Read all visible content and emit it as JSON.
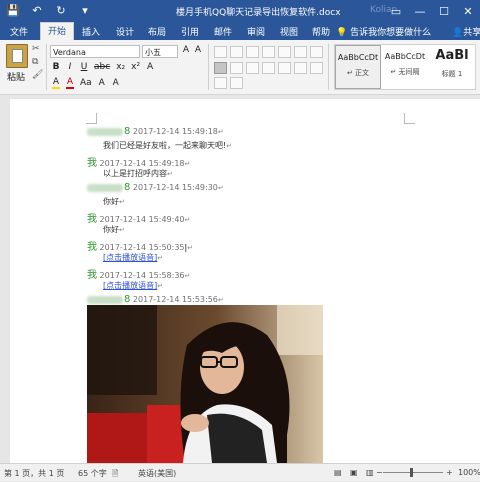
{
  "title": "楼月手机QQ聊天记录导出恢复软件.docx",
  "user": "Kolian",
  "window_controls": [
    "▭",
    "—",
    "☐",
    "✕"
  ],
  "tabs": [
    "文件",
    "开始",
    "插入",
    "设计",
    "布局",
    "引用",
    "邮件",
    "审阅",
    "视图",
    "帮助"
  ],
  "active_tab": "开始",
  "tell_me": "告诉我你想要做什么",
  "share": "共享",
  "ribbon": {
    "paste": "粘贴",
    "font_name": "Verdana",
    "font_size": "小五",
    "font_row1": [
      "A",
      "A",
      "Aa",
      "A",
      "wén",
      "A"
    ],
    "font_row2": [
      "B",
      "I",
      "U",
      "abc",
      "x₂",
      "x²",
      "A"
    ],
    "font_row3": [
      "A",
      "A",
      "Aa",
      "A",
      "A"
    ],
    "styles": [
      {
        "sample": "AaBbCcDt",
        "name": "↵ 正文"
      },
      {
        "sample": "AaBbCcDt",
        "name": "↵ 无间隔"
      },
      {
        "sample": "AaBl",
        "name": "标题 1"
      }
    ]
  },
  "document": {
    "messages": [
      {
        "type": "meta",
        "sender_suffix": "8",
        "time": "2017-12-14 15:49:18"
      },
      {
        "type": "text",
        "text": "我们已经是好友啦，一起来聊天吧!"
      },
      {
        "type": "meta",
        "sender": "我",
        "time": "2017-12-14 15:49:18"
      },
      {
        "type": "text",
        "text": "以上是打招呼内容"
      },
      {
        "type": "meta",
        "sender_suffix": "8",
        "time": "2017-12-14 15:49:30"
      },
      {
        "type": "text",
        "text": "你好"
      },
      {
        "type": "meta",
        "sender": "我",
        "time": "2017-12-14 15:49:40"
      },
      {
        "type": "text",
        "text": "你好"
      },
      {
        "type": "meta",
        "sender": "我",
        "time": "2017-12-14 15:50:35"
      },
      {
        "type": "link",
        "text": "[点击播放语音]"
      },
      {
        "type": "meta",
        "sender": "我",
        "time": "2017-12-14 15:58:36"
      },
      {
        "type": "link",
        "text": "[点击播放语音]"
      },
      {
        "type": "meta",
        "sender_suffix": "8",
        "time": "2017-12-14 15:53:56"
      }
    ]
  },
  "status": {
    "page": "第 1 页，共 1 页",
    "words": "65 个字",
    "language": "英语(美国)",
    "zoom": "100%"
  }
}
